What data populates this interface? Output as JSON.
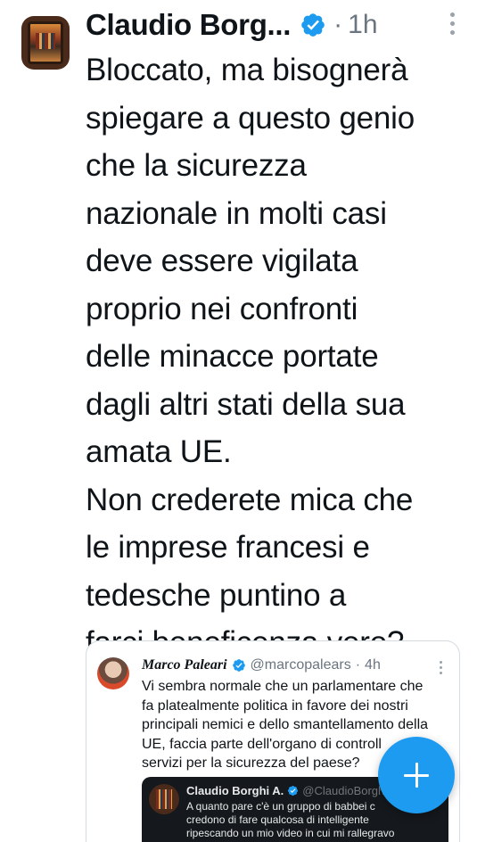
{
  "tweet": {
    "author_name": "Claudio Borg...",
    "separator": "·",
    "time": "1h",
    "verified": true,
    "avatar_icon": "painting-avatar",
    "text_lines": [
      "Bloccato, ma bisognerà",
      "spiegare a questo genio",
      "che la sicurezza",
      "nazionale in molti casi",
      "deve essere vigilata",
      "proprio nei confronti",
      "delle minacce portate",
      "dagli altri stati della sua",
      "amata UE.",
      "Non crederete mica che",
      "le imprese francesi e",
      "tedesche puntino a",
      "farci beneficenza vero?"
    ]
  },
  "quoted": {
    "author_name": "Marco Paleari",
    "handle": "@marcopalears",
    "separator": "·",
    "time": "4h",
    "verified": true,
    "text_lines": [
      "Vi sembra normale che un parlamentare che",
      "fa platealmente politica in favore dei nostri",
      "principali nemici e dello smantellamento della",
      "UE, faccia parte dell'organo di controll",
      "servizi per la sicurezza del paese?"
    ],
    "inner_quote": {
      "author_name": "Claudio Borghi A.",
      "handle": "@ClaudioBorghi",
      "verified": true,
      "text_lines": [
        "A quanto pare c'è un gruppo di babbei c",
        "credono di fare qualcosa di intelligente",
        "ripescando un mio video in cui mi rallegravo"
      ]
    }
  },
  "compose_button": {
    "icon": "plus-icon",
    "color": "#1d9bf0"
  },
  "colors": {
    "verified_blue": "#1d9bf0",
    "text_primary": "#0f1419",
    "text_secondary": "#6b7580"
  }
}
